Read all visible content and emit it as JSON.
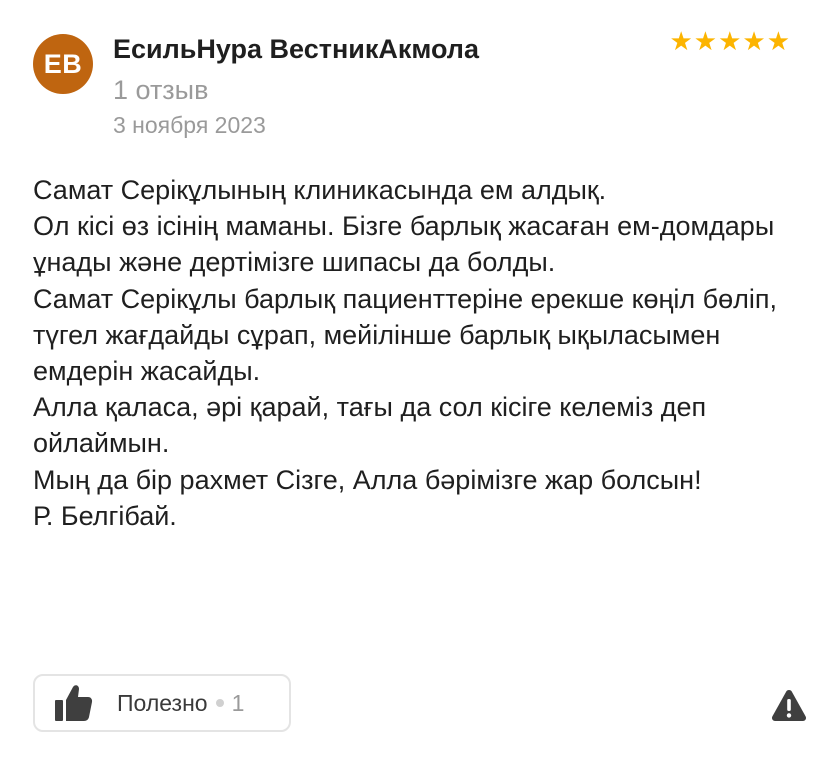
{
  "review": {
    "avatar_initials": "ЕВ",
    "avatar_color": "#bf6510",
    "author": "ЕсильНура ВестникАкмола",
    "review_count": "1 отзыв",
    "date": "3 ноября 2023",
    "rating": 5,
    "star_color": "#fcb400",
    "text_lines": [
      "Самат Серікұлының клиникасында ем алдық.",
      "Ол кісі өз ісінің маманы. Бізге барлық жасаған ем-домдары ұнады және дертімізге шипасы да болды.",
      "Самат Серікұлы барлық пациенттеріне ерекше көңіл бөліп, түгел жағдайды сұрап, мейілінше барлық ықыласымен емдерін жасайды.",
      "Алла қаласа, әрі қарай, тағы да сол кісіге келеміз деп ойлаймын.",
      "Мың да бір рахмет Сізге, Алла бәрімізге жар болсын!",
      "Р. Белгібай."
    ]
  },
  "actions": {
    "useful_label": "Полезно",
    "useful_count": "1",
    "like_icon": "thumbs-up-icon",
    "report_icon": "warning-icon"
  }
}
